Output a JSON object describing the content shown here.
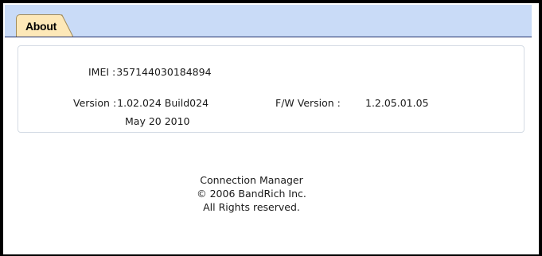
{
  "tabs": {
    "active_label": "About"
  },
  "device": {
    "imei_label": "IMEI :",
    "imei_value": "357144030184894",
    "version_label": "Version :",
    "version_value": "1.02.024 Build024",
    "version_date": "May 20 2010",
    "fw_label": "F/W Version :",
    "fw_value": "1.2.05.01.05"
  },
  "footer": {
    "product": "Connection Manager",
    "copyright": "© 2006 BandRich Inc.",
    "rights": "All Rights reserved."
  },
  "colors": {
    "tab_bar": "#c9dbf7",
    "active_tab": "#fde8b8",
    "panel_border": "#d4dbe4"
  }
}
